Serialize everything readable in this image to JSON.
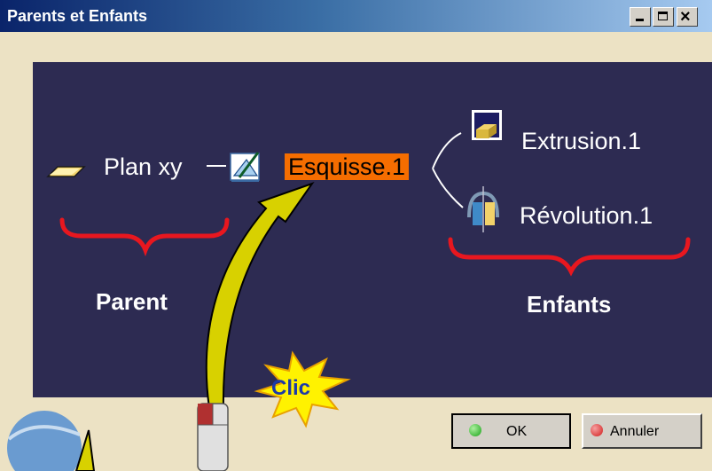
{
  "window": {
    "title": "Parents et Enfants"
  },
  "tree": {
    "parent_node": {
      "label": "Plan xy",
      "icon": "plane-icon"
    },
    "current_node": {
      "label": "Esquisse.1",
      "icon": "sketch-icon"
    },
    "children": [
      {
        "label": "Extrusion.1",
        "icon": "pad-icon"
      },
      {
        "label": "Révolution.1",
        "icon": "shaft-icon"
      }
    ]
  },
  "annotations": {
    "parent_label": "Parent",
    "children_label": "Enfants",
    "click_label": "Clic"
  },
  "buttons": {
    "ok_label": "OK",
    "cancel_label": "Annuler"
  },
  "colors": {
    "panel_bg": "#2d2b52",
    "selection": "#f56d00",
    "brace": "#e8171f",
    "callout": "#d8d100"
  }
}
